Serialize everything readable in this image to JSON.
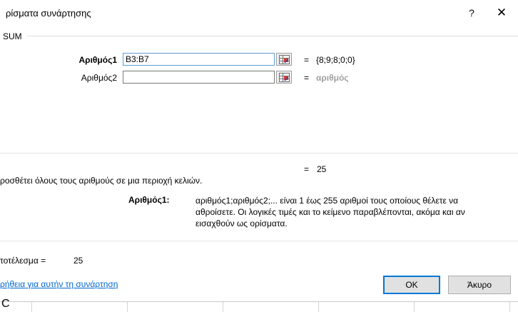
{
  "dialog": {
    "title": "ρίσματα συνάρτησης",
    "help_glyph": "?",
    "close_glyph": "✕",
    "function_name": "SUM"
  },
  "args": [
    {
      "label": "Αριθμός1",
      "value": "B3:B7",
      "result_eq": "=",
      "result": "{8;9;8;0;0}",
      "active": true
    },
    {
      "label": "Αριθμός2",
      "value": "",
      "result_eq": "=",
      "result": "αριθμός",
      "active": false
    }
  ],
  "formula_result": {
    "eq": "=",
    "value": "25"
  },
  "description": "ροσθέτει όλους τους αριθμούς σε μια περιοχή κελιών.",
  "arg_help": {
    "label": "Αριθμός1:",
    "lines": [
      "αριθμός1;αριθμός2;... είναι 1 έως 255 αριθμοί τους οποίους θέλετε να",
      "αθροίσετε. Οι λογικές τιμές και το κείμενο παραβλέπονται, ακόμα και αν",
      "εισαχθούν ως ορίσματα."
    ]
  },
  "final_result": {
    "label": "τοτέλεσμα =",
    "value": "25"
  },
  "help_link": "ρήθεια για αυτήν τη συνάρτηση",
  "buttons": {
    "ok": "OK",
    "cancel": "Άκυρο"
  },
  "sheet_fragment": "C",
  "colors": {
    "link": "#0066cc",
    "default_button_border": "#0078d7",
    "hint_gray": "#a0a0a0"
  }
}
